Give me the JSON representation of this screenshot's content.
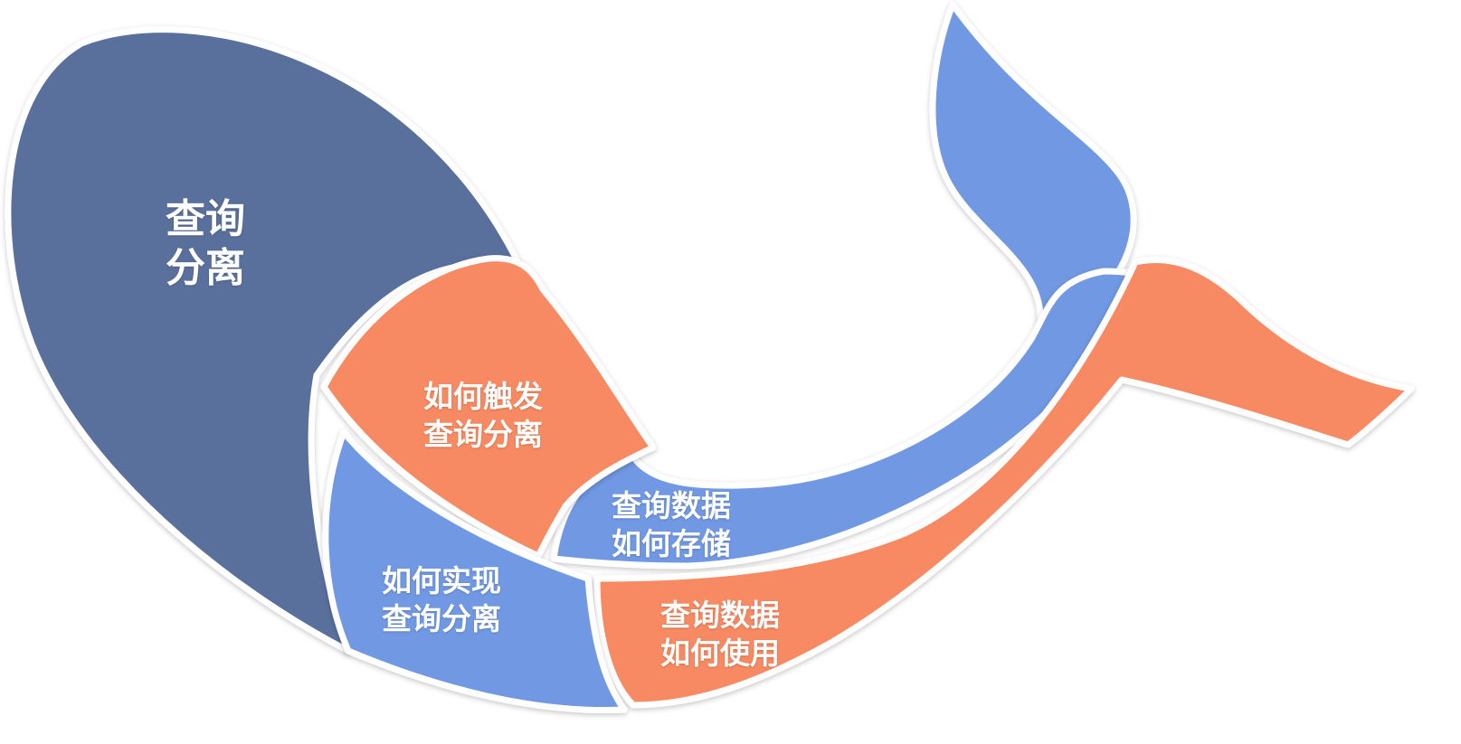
{
  "colors": {
    "dark_blue": "#5A6F9C",
    "light_blue": "#7198E3",
    "orange": "#F78A62",
    "text": "#FFFFFF"
  },
  "labels": {
    "main": [
      "查询",
      "分离"
    ],
    "trigger": [
      "如何触发",
      "查询分离"
    ],
    "storage": [
      "查询数据",
      "如何存储"
    ],
    "implement": [
      "如何实现",
      "查询分离"
    ],
    "usage": [
      "查询数据",
      "如何使用"
    ]
  }
}
